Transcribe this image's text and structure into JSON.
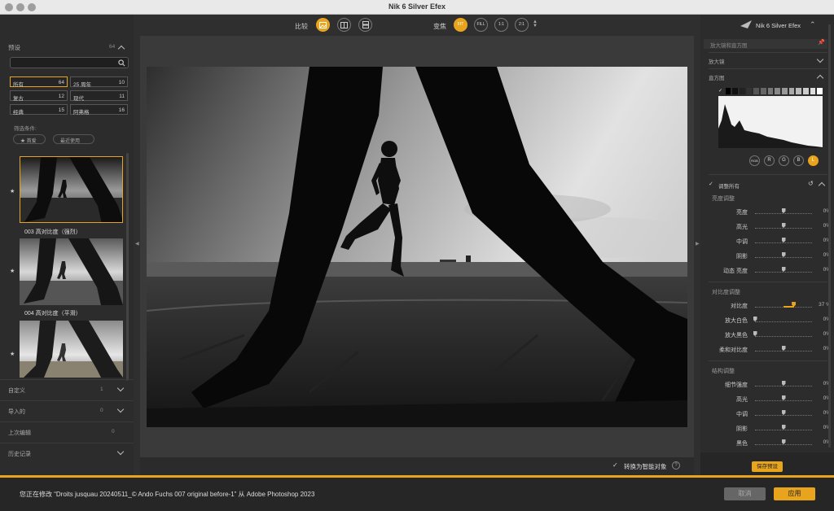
{
  "window": {
    "title": "Nik 6 Silver Efex"
  },
  "left_panel": {
    "presets_label": "预设",
    "presets_count": "64",
    "search_placeholder": "",
    "categories": [
      {
        "label": "所有",
        "count": "64",
        "selected": true
      },
      {
        "label": "25 周年",
        "count": "10"
      },
      {
        "label": "复古",
        "count": "12"
      },
      {
        "label": "现代",
        "count": "11"
      },
      {
        "label": "经典",
        "count": "15"
      },
      {
        "label": "阿弗格",
        "count": "16"
      }
    ],
    "filter_label": "筛选条件:",
    "filter_pills": [
      "★ 首爱",
      "最近使用"
    ],
    "thumbnails": [
      {
        "caption": "003 高对比度（强烈）",
        "starred": true,
        "selected": true
      },
      {
        "caption": "004 高对比度（平滑）",
        "starred": true
      },
      {
        "caption": "",
        "starred": true
      }
    ],
    "sections": [
      {
        "label": "自定义",
        "count": "1"
      },
      {
        "label": "导入的",
        "count": "0"
      },
      {
        "label": "上次编辑",
        "count": "0"
      },
      {
        "label": "历史记录",
        "count": ""
      }
    ]
  },
  "center": {
    "compare_label": "比较",
    "zoom_label": "变焦",
    "zoom_buttons": [
      "FIT",
      "FILL",
      "1:1",
      "2:1"
    ],
    "smart_object_label": "转换为智能对象",
    "help_icon": "?"
  },
  "right_panel": {
    "brand": "Nik 6 Silver Efex",
    "loupe_label": "放大镜和直方图",
    "magnifier_label": "放大镜",
    "histogram_label": "直方图",
    "channel_buttons": [
      "RGB",
      "R",
      "G",
      "B",
      "L"
    ],
    "adjust_all_label": "调整所有",
    "brightness_group": "亮度调整",
    "brightness_sliders": [
      {
        "label": "亮度",
        "value": "0%",
        "level": 0.5
      },
      {
        "label": "高光",
        "value": "0%",
        "level": 0.5
      },
      {
        "label": "中调",
        "value": "0%",
        "level": 0.5
      },
      {
        "label": "阴影",
        "value": "0%",
        "level": 0.5
      },
      {
        "label": "动态 亮度",
        "value": "0%",
        "level": 0.5
      }
    ],
    "contrast_group": "对比度调整",
    "contrast_sliders": [
      {
        "label": "对比度",
        "value": "37 %",
        "level": 0.68,
        "active": true
      },
      {
        "label": "放大白色",
        "value": "0%",
        "level": 0.0
      },
      {
        "label": "放大黑色",
        "value": "0%",
        "level": 0.0
      },
      {
        "label": "柔和对比度",
        "value": "0%",
        "level": 0.5
      }
    ],
    "structure_group": "结构调整",
    "structure_sliders": [
      {
        "label": "细节强度",
        "value": "0%",
        "level": 0.5
      },
      {
        "label": "高光",
        "value": "0%",
        "level": 0.5
      },
      {
        "label": "中调",
        "value": "0%",
        "level": 0.5
      },
      {
        "label": "阴影",
        "value": "0%",
        "level": 0.5
      },
      {
        "label": "黑色",
        "value": "0%",
        "level": 0.5
      }
    ],
    "save_preset_label": "保存预设"
  },
  "bottom": {
    "status_text": "您正在修改 “Droits jusquau 20240511_© Ando Fuchs 007 original before-1” 从 Adobe Photoshop 2023",
    "cancel_label": "取消",
    "apply_label": "应用"
  },
  "colors": {
    "accent": "#e8a41c",
    "panel": "#2c2c2c",
    "canvas": "#3a3a3a"
  }
}
